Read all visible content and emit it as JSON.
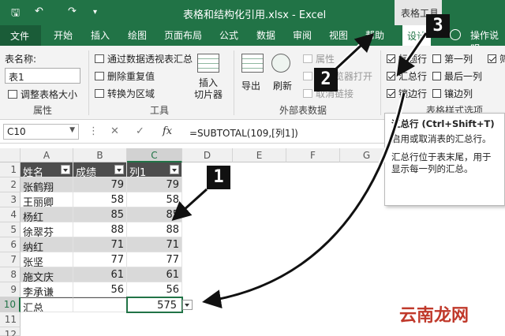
{
  "titlebar": {
    "title": "表格和结构化引用.xlsx  -  Excel",
    "context_tab": "表格工具",
    "quick_access": [
      "save-icon",
      "undo-icon",
      "redo-icon",
      "customize-icon"
    ]
  },
  "tabs": [
    "文件",
    "开始",
    "插入",
    "绘图",
    "页面布局",
    "公式",
    "数据",
    "审阅",
    "视图",
    "帮助",
    "设计",
    "操作说明"
  ],
  "ribbon": {
    "properties": {
      "name_label": "表名称:",
      "name_value": "表1",
      "resize": "调整表格大小",
      "group": "属性"
    },
    "tools": {
      "pivot": "通过数据透视表汇总",
      "dedupe": "删除重复值",
      "convert": "转换为区域",
      "slicer": "插入\n切片器",
      "group": "工具"
    },
    "external": {
      "export": "导出",
      "refresh": "刷新",
      "props": "属性",
      "open_browser": "用浏览器打开",
      "unlink": "取消链接",
      "group": "外部表数据"
    },
    "style_options": {
      "header_row": "标题行",
      "total_row": "汇总行",
      "banded_rows": "镶边行",
      "first_col": "第一列",
      "last_col": "最后一列",
      "banded_cols": "镶边列",
      "filter_btn": "筛",
      "group": "表格样式选项"
    }
  },
  "formula_bar": {
    "name_box": "C10",
    "formula": "=SUBTOTAL(109,[列1])",
    "fx": "fx"
  },
  "grid": {
    "columns": [
      "A",
      "B",
      "C",
      "D",
      "E",
      "F",
      "G"
    ],
    "rows": [
      "1",
      "2",
      "3",
      "4",
      "5",
      "6",
      "7",
      "8",
      "9",
      "10",
      "11",
      "12"
    ],
    "headers": [
      "姓名",
      "成绩",
      "列1"
    ],
    "data": [
      [
        "张鹤翔",
        "79",
        "79"
      ],
      [
        "王丽卿",
        "58",
        "58"
      ],
      [
        "杨红",
        "85",
        "85"
      ],
      [
        "徐翠芬",
        "88",
        "88"
      ],
      [
        "纳红",
        "71",
        "71"
      ],
      [
        "张坚",
        "77",
        "77"
      ],
      [
        "施文庆",
        "61",
        "61"
      ],
      [
        "李承谦",
        "56",
        "56"
      ]
    ],
    "total_label": "汇总",
    "total_value": "575"
  },
  "tooltip": {
    "title": "汇总行 (Ctrl+Shift+T)",
    "line1": "启用或取消表的汇总行。",
    "line2": "汇总行位于表末尾，用于显示每一列的汇总。"
  },
  "badges": [
    "1",
    "2",
    "3"
  ],
  "watermark": "云南龙网"
}
